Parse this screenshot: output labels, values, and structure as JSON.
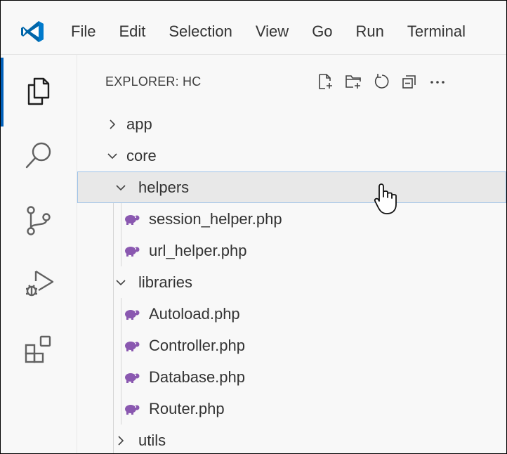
{
  "window": {
    "menu": [
      "File",
      "Edit",
      "Selection",
      "View",
      "Go",
      "Run",
      "Terminal"
    ]
  },
  "activity_bar": {
    "icons": [
      "explorer-icon",
      "search-icon",
      "source-control-icon",
      "run-debug-icon",
      "extensions-icon"
    ],
    "active": "explorer-icon"
  },
  "explorer": {
    "title": "EXPLORER: HC",
    "actions": [
      "new-file-icon",
      "new-folder-icon",
      "refresh-icon",
      "collapse-all-icon",
      "more-icon"
    ],
    "tree": [
      {
        "label": "app",
        "type": "folder",
        "expanded": false,
        "depth": 0
      },
      {
        "label": "core",
        "type": "folder",
        "expanded": true,
        "depth": 0
      },
      {
        "label": "helpers",
        "type": "folder",
        "expanded": true,
        "depth": 1,
        "hovered": true
      },
      {
        "label": "session_helper.php",
        "type": "php",
        "depth": 2
      },
      {
        "label": "url_helper.php",
        "type": "php",
        "depth": 2
      },
      {
        "label": "libraries",
        "type": "folder",
        "expanded": true,
        "depth": 1
      },
      {
        "label": "Autoload.php",
        "type": "php",
        "depth": 2
      },
      {
        "label": "Controller.php",
        "type": "php",
        "depth": 2
      },
      {
        "label": "Database.php",
        "type": "php",
        "depth": 2
      },
      {
        "label": "Router.php",
        "type": "php",
        "depth": 2
      },
      {
        "label": "utils",
        "type": "folder",
        "expanded": false,
        "depth": 1
      }
    ]
  },
  "colors": {
    "accent": "#005fb8",
    "php_icon": "#8a58b0",
    "hover_row": "#e8e8e8",
    "hover_outline": "#9fc3e8"
  }
}
